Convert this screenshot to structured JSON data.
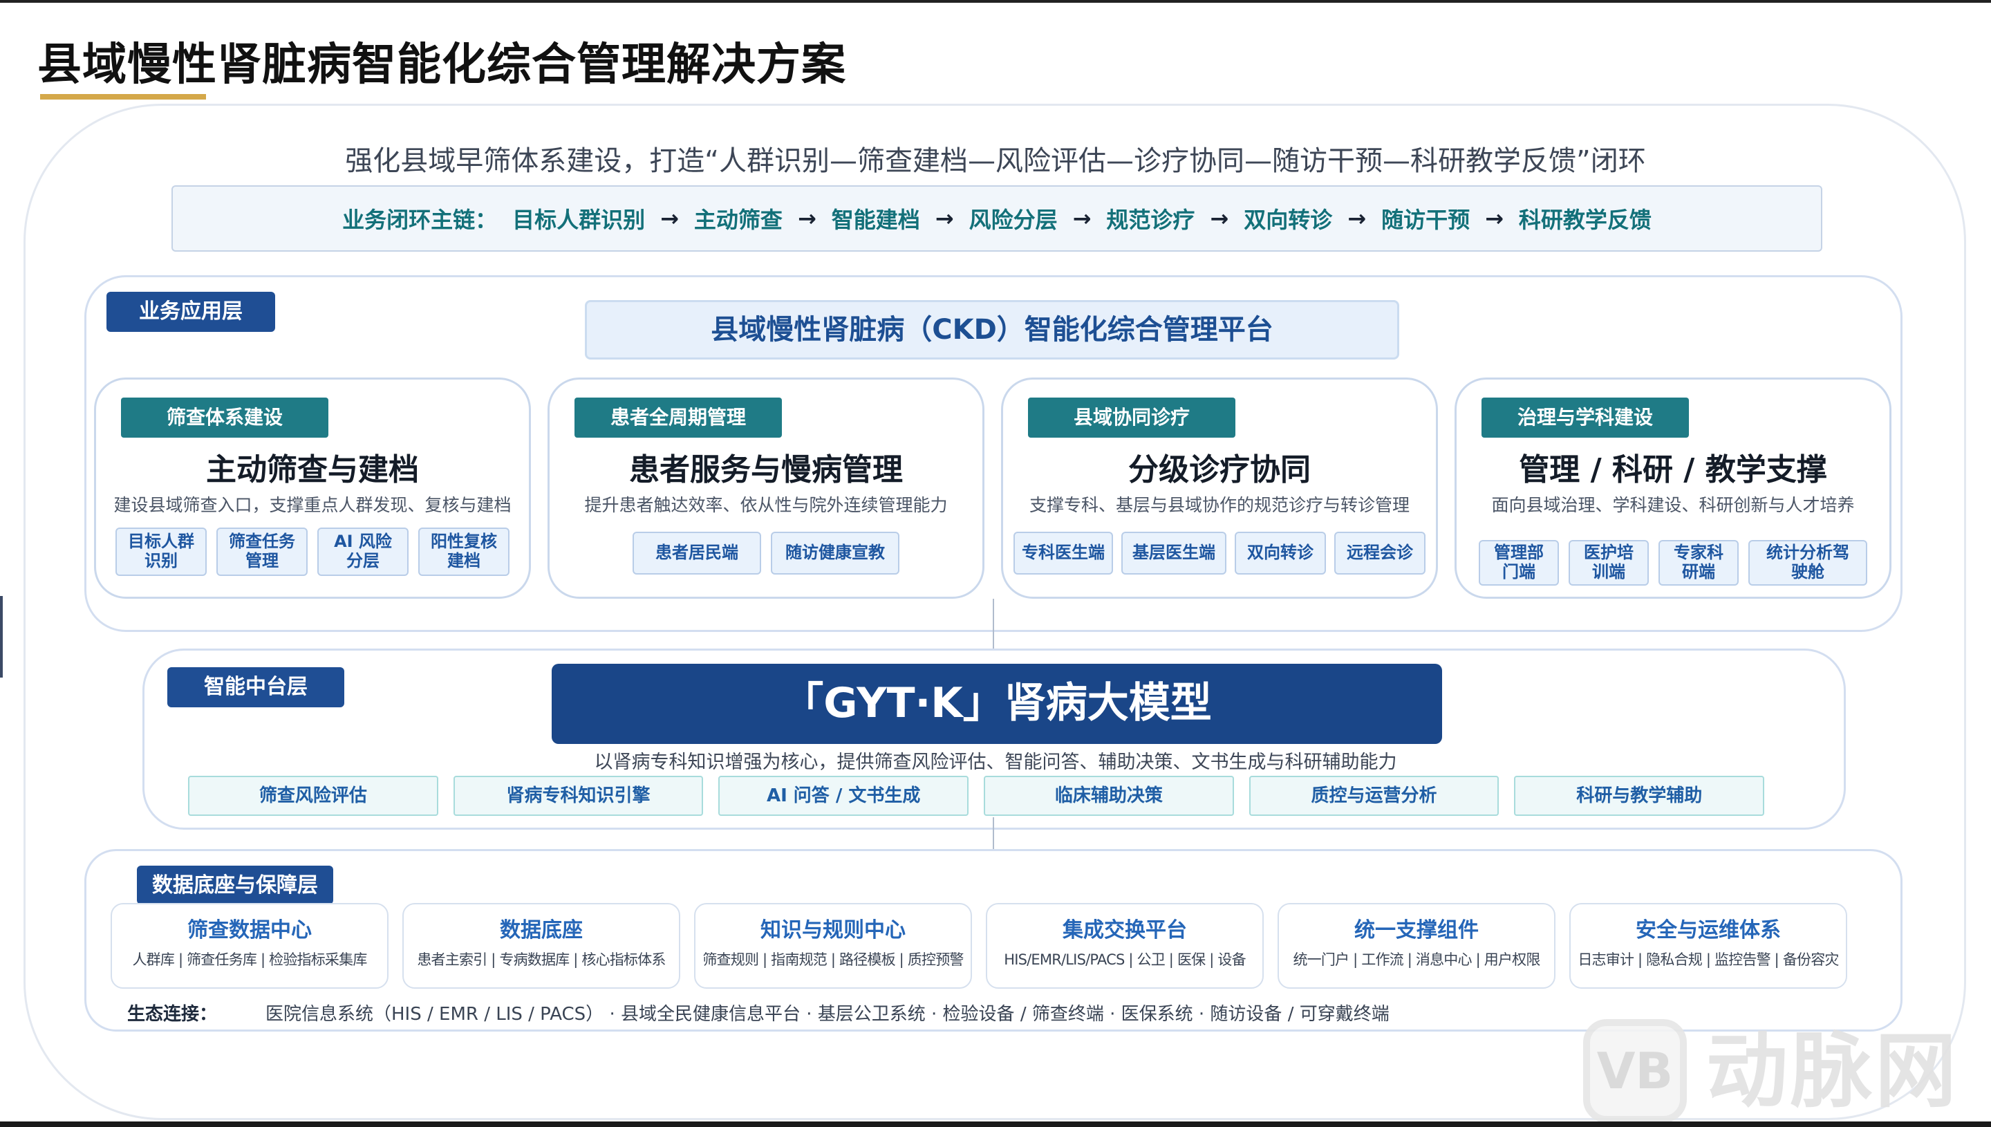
{
  "header": {
    "title": "县域慢性肾脏病智能化综合管理解决方案",
    "subtitle": "强化县域早筛体系建设，打造“人群识别—筛查建档—风险评估—诊疗协同—随访干预—科研教学反馈”闭环"
  },
  "chain": {
    "label": "业务闭环主链：",
    "arrow": "→",
    "steps": [
      "目标人群识别",
      "主动筛查",
      "智能建档",
      "风险分层",
      "规范诊疗",
      "双向转诊",
      "随访干预",
      "科研教学反馈"
    ]
  },
  "business_layer": {
    "tag": "业务应用层",
    "platform": "县域慢性肾脏病（CKD）智能化综合管理平台",
    "cards": [
      {
        "badge": "筛查体系建设",
        "title": "主动筛查与建档",
        "desc": "建设县域筛查入口，支撑重点人群发现、复核与建档",
        "items": [
          "目标人群\n识别",
          "筛查任务\n管理",
          "AI 风险\n分层",
          "阳性复核\n建档"
        ]
      },
      {
        "badge": "患者全周期管理",
        "title": "患者服务与慢病管理",
        "desc": "提升患者触达效率、依从性与院外连续管理能力",
        "items": [
          "患者居民端",
          "随访健康宣教"
        ]
      },
      {
        "badge": "县域协同诊疗",
        "title": "分级诊疗协同",
        "desc": "支撑专科、基层与县域协作的规范诊疗与转诊管理",
        "items": [
          "专科医生端",
          "基层医生端",
          "双向转诊",
          "远程会诊"
        ]
      },
      {
        "badge": "治理与学科建设",
        "title": "管理 / 科研 / 教学支撑",
        "desc": "面向县域治理、学科建设、科研创新与人才培养",
        "items": [
          "管理部\n门端",
          "医护培\n训端",
          "专家科\n研端",
          "统计分析驾\n驶舱"
        ]
      }
    ]
  },
  "ai_layer": {
    "tag": "智能中台层",
    "model": "「GYT·K」肾病大模型",
    "desc": "以肾病专科知识增强为核心，提供筛查风险评估、智能问答、辅助决策、文书生成与科研辅助能力",
    "capabilities": [
      "筛查风险评估",
      "肾病专科知识引擎",
      "AI 问答 / 文书生成",
      "临床辅助决策",
      "质控与运营分析",
      "科研与教学辅助"
    ]
  },
  "data_layer": {
    "tag": "数据底座与保障层",
    "centers": [
      {
        "title": "筛查数据中心",
        "desc": "人群库 | 筛查任务库 | 检验指标采集库"
      },
      {
        "title": "数据底座",
        "desc": "患者主索引 | 专病数据库 | 核心指标体系"
      },
      {
        "title": "知识与规则中心",
        "desc": "筛查规则 | 指南规范 | 路径模板 | 质控预警"
      },
      {
        "title": "集成交换平台",
        "desc": "HIS/EMR/LIS/PACS | 公卫 | 医保 | 设备"
      },
      {
        "title": "统一支撑组件",
        "desc": "统一门户 | 工作流 | 消息中心 | 用户权限"
      },
      {
        "title": "安全与运维体系",
        "desc": "日志审计 | 隐私合规 | 监控告警 | 备份容灾"
      }
    ],
    "eco_label": "生态连接：",
    "eco_text": "医院信息系统（HIS / EMR / LIS / PACS） · 县域全民健康信息平台 · 基层公卫系统 · 检验设备 / 筛查终端 · 医保系统 · 随访设备 / 可穿戴终端"
  },
  "watermark": {
    "logo": "VB",
    "text": "动脉网"
  },
  "colors": {
    "primary_navy": "#1f4e94",
    "model_navy": "#1a4688",
    "teal": "#1f7b86",
    "chain_teal": "#137079",
    "accent_gold": "#d4a84a"
  }
}
